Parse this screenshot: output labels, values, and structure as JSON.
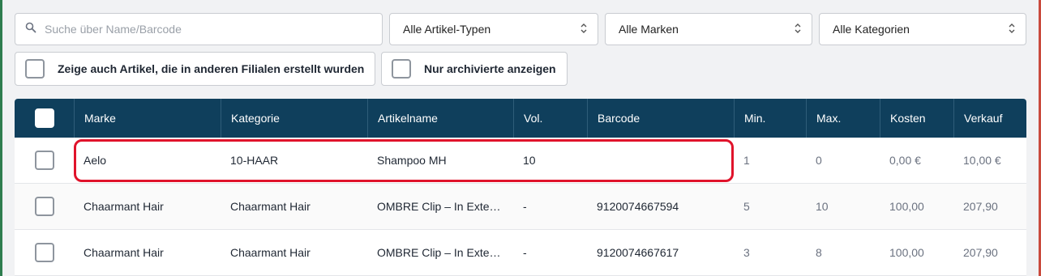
{
  "filters": {
    "search_placeholder": "Suche über Name/Barcode",
    "article_type": "Alle Artikel-Typen",
    "brand": "Alle Marken",
    "category": "Alle Kategorien",
    "show_other_branches": "Zeige auch Artikel, die in anderen Filialen erstellt wurden",
    "only_archived": "Nur archivierte anzeigen"
  },
  "table": {
    "headers": [
      "Marke",
      "Kategorie",
      "Artikelname",
      "Vol.",
      "Barcode",
      "Min.",
      "Max.",
      "Kosten",
      "Verkauf"
    ],
    "rows": [
      [
        "Aelo",
        "10-HAAR",
        "Shampoo MH",
        "10",
        "",
        "1",
        "0",
        "0,00 €",
        "10,00 €"
      ],
      [
        "Chaarmant Hair",
        "Chaarmant Hair",
        "OMBRE Clip – In Exte…",
        "-",
        "9120074667594",
        "5",
        "10",
        "100,00",
        "207,90"
      ],
      [
        "Chaarmant Hair",
        "Chaarmant Hair",
        "OMBRE Clip – In Exte…",
        "-",
        "9120074667617",
        "3",
        "8",
        "100,00",
        "207,90"
      ]
    ]
  },
  "colors": {
    "header_bg": "#0f3f5c",
    "highlight": "#e0132b"
  }
}
